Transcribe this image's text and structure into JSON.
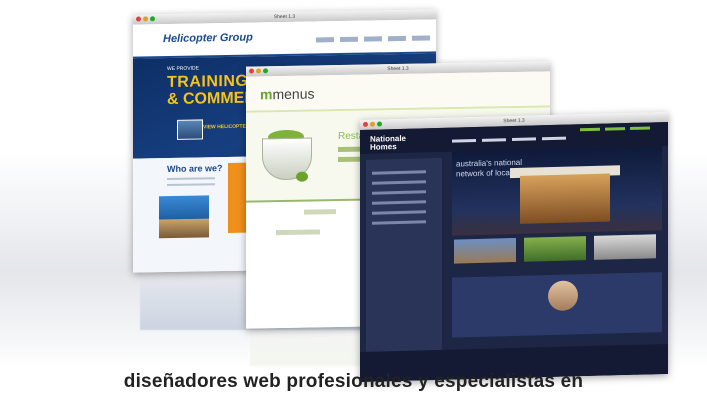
{
  "windows": [
    {
      "title": "Sheet 1.3",
      "logo": "Helicopter Group",
      "hero_small": "WE PROVIDE",
      "hero_line1": "TRAINING, CHARTER",
      "hero_line2": "& COMMERCIAL",
      "photo_link": "VIEW HELICOPTER PHOTO GALLERY",
      "section_title": "Who are we?"
    },
    {
      "title": "Sheet 1.3",
      "logo_prefix": "m",
      "logo_text": "menus",
      "headline": "Restaurant"
    },
    {
      "title": "Sheet 1.3",
      "logo_line1": "Nationale",
      "logo_line2": "Homes",
      "hero_line1": "australia's national",
      "hero_line2": "network of local"
    }
  ],
  "caption": "diseñadores web profesionales y especialistas en"
}
